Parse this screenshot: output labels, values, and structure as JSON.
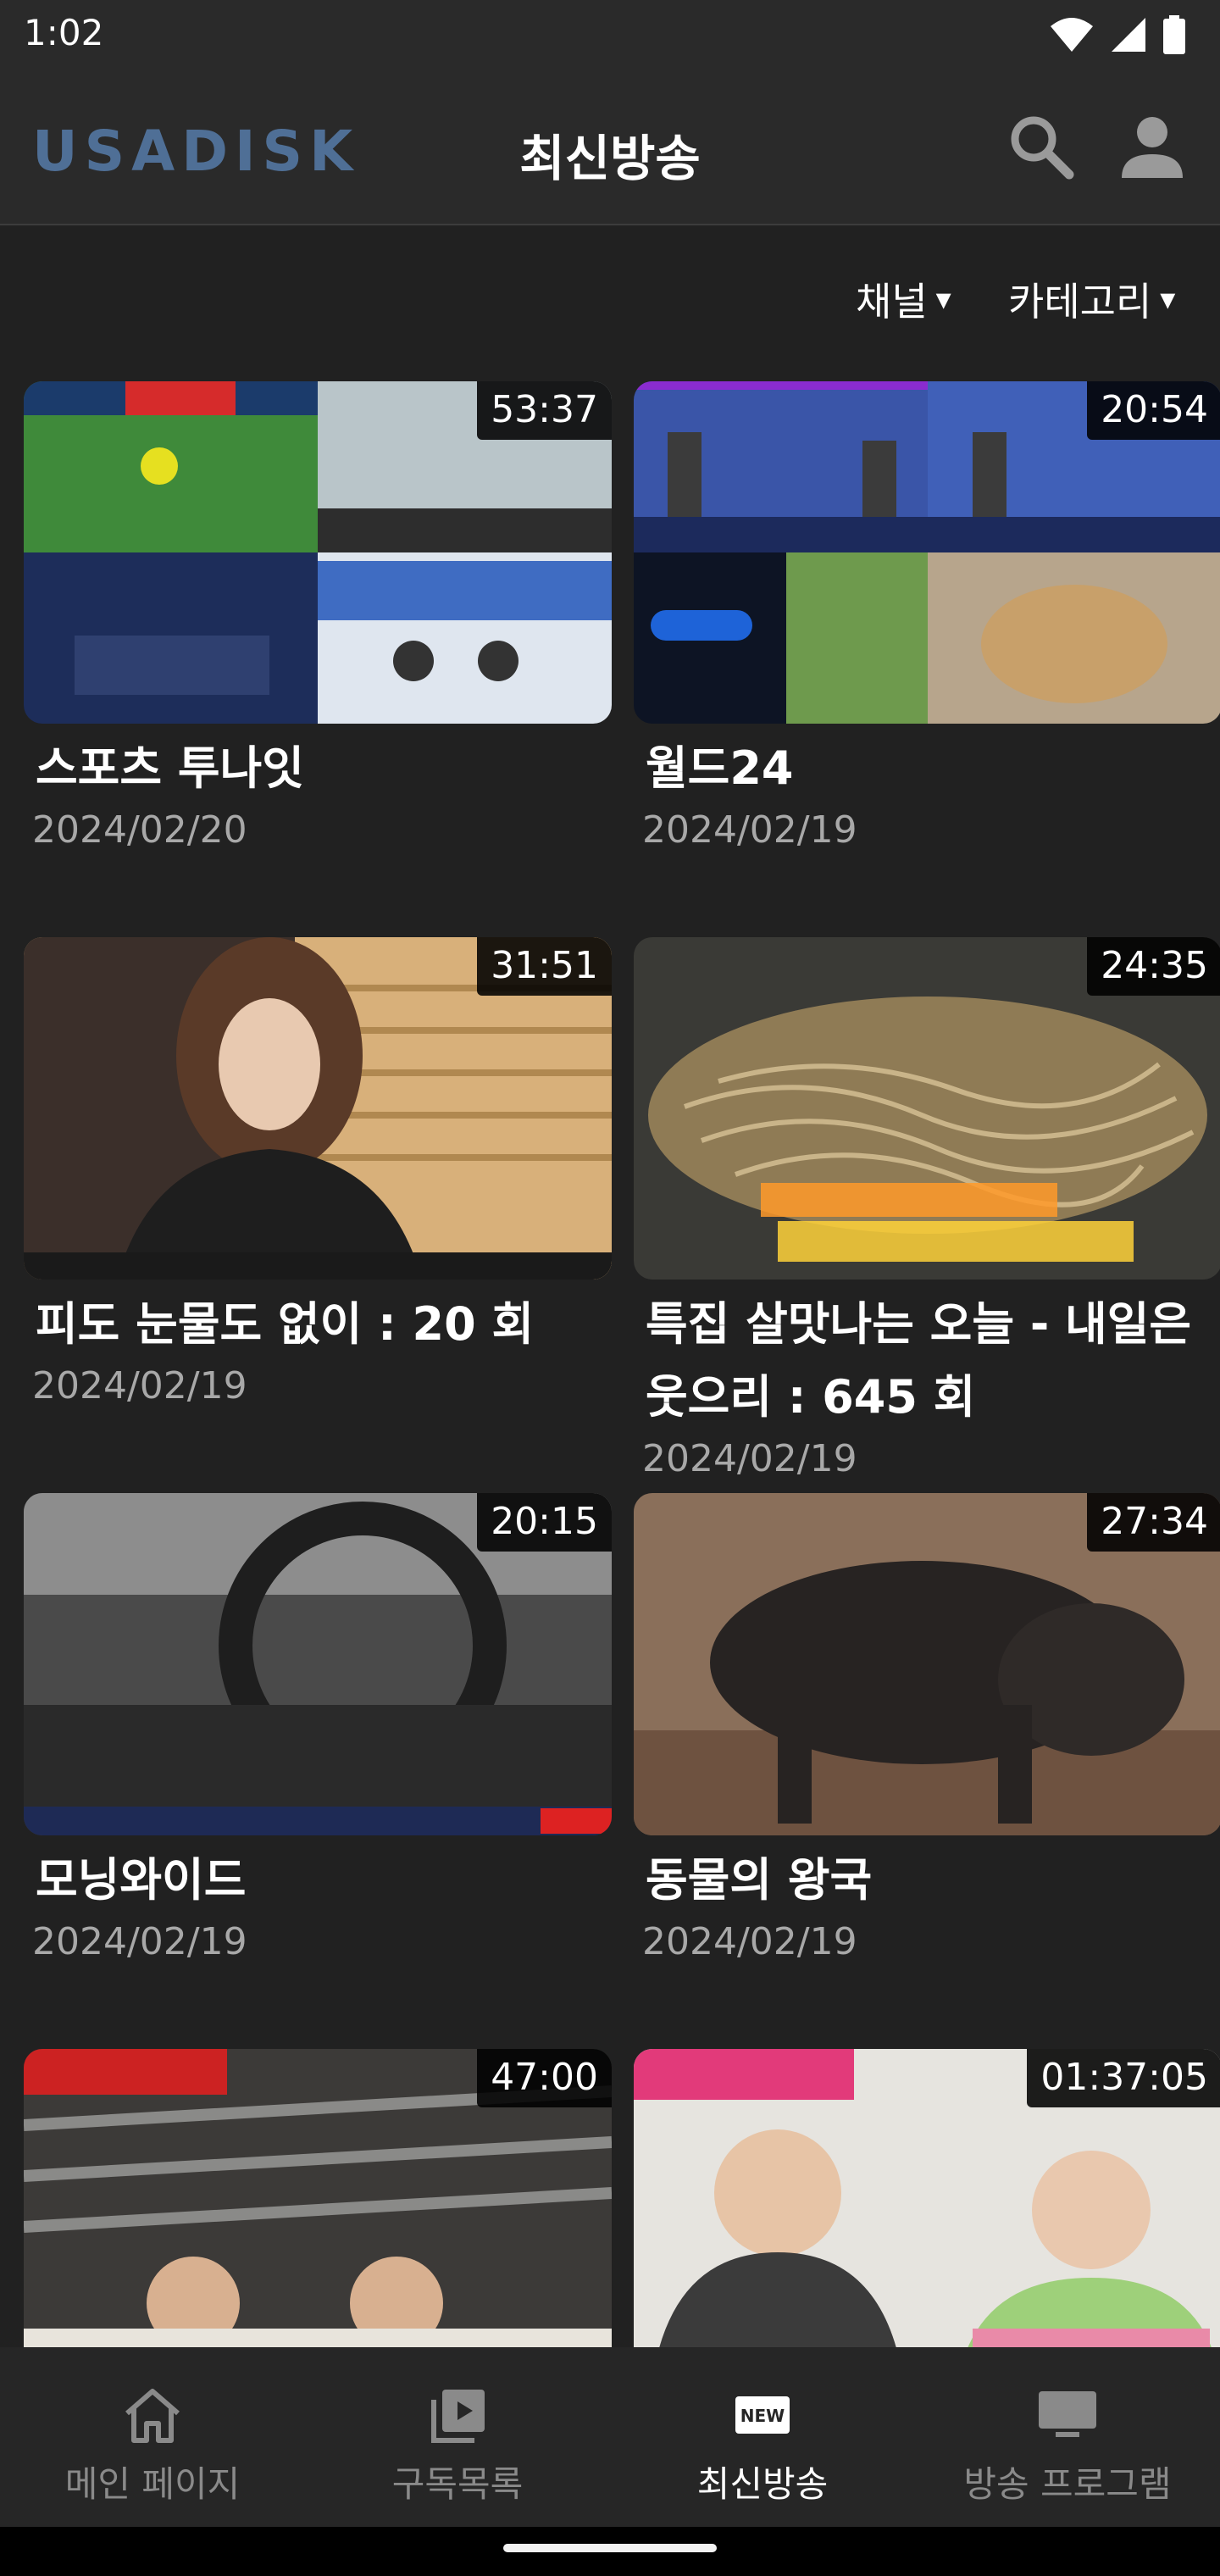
{
  "status_bar": {
    "time": "1:02"
  },
  "app_bar": {
    "logo": "USADISK",
    "title": "최신방송",
    "search_icon": "search-icon",
    "profile_icon": "profile-icon"
  },
  "filters": {
    "channel": "채널",
    "category": "카테고리",
    "caret": "▾"
  },
  "videos": [
    {
      "title": "스포츠 투나잇",
      "date": "2024/02/20",
      "duration": "53:37"
    },
    {
      "title": "월드24",
      "date": "2024/02/19",
      "duration": "20:54"
    },
    {
      "title": "피도 눈물도 없이 : 20 회",
      "date": "2024/02/19",
      "duration": "31:51"
    },
    {
      "title": "특집 살맛나는 오늘 - 내일은 웃으리 : 645 회",
      "date": "2024/02/19",
      "duration": "24:35"
    },
    {
      "title": "모닝와이드",
      "date": "2024/02/19",
      "duration": "20:15"
    },
    {
      "title": "동물의 왕국",
      "date": "2024/02/19",
      "duration": "27:34"
    },
    {
      "title": "",
      "date": "",
      "duration": "47:00"
    },
    {
      "title": "",
      "date": "",
      "duration": "01:37:05"
    }
  ],
  "bottom_nav": [
    {
      "label": "메인 페이지",
      "icon": "home-icon",
      "active": false
    },
    {
      "label": "구독목록",
      "icon": "playlist-icon",
      "active": false
    },
    {
      "label": "최신방송",
      "icon": "new-icon",
      "active": true
    },
    {
      "label": "방송 프로그램",
      "icon": "tv-icon",
      "active": false
    }
  ],
  "colors": {
    "background": "#212121",
    "app_bar": "#2a2a2a",
    "logo": "#4f6f96",
    "inactive": "#8a8a8a",
    "date": "#a8a8a8"
  }
}
